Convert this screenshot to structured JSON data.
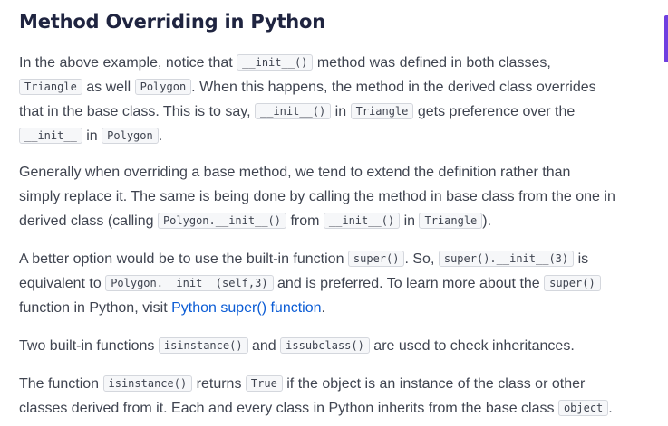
{
  "heading": "Method Overriding in Python",
  "p1": {
    "l1a": "In the above example, notice that ",
    "c1": "__init__()",
    "l1b": " method was defined in both classes,",
    "c2": "Triangle",
    "l2a": " as well ",
    "c3": "Polygon",
    "l2b": ". When this happens, the method in the derived class overrides",
    "l3a": "that in the base class. This is to say, ",
    "c4": "__init__()",
    "l3b": " in ",
    "c5": "Triangle",
    "l3c": " gets preference over the",
    "c6": "__init__",
    "l4a": " in ",
    "c7": "Polygon",
    "l4b": "."
  },
  "p2": {
    "l1": "Generally when overriding a base method, we tend to extend the definition rather than",
    "l2": "simply replace it. The same is being done by calling the method in base class from the one in",
    "l3a": "derived class (calling ",
    "c1": "Polygon.__init__()",
    "l3b": " from ",
    "c2": "__init__()",
    "l3c": " in ",
    "c3": "Triangle",
    "l3d": ")."
  },
  "p3": {
    "l1a": "A better option would be to use the built-in function ",
    "c1": "super()",
    "l1b": ". So, ",
    "c2": "super().__init__(3)",
    "l1c": " is",
    "l2a": "equivalent to ",
    "c3": "Polygon.__init__(self,3)",
    "l2b": " and is preferred. To learn more about the ",
    "c4": "super()",
    "l3a": "function in Python, visit ",
    "link": "Python super() function",
    "l3b": "."
  },
  "p4": {
    "l1a": "Two built-in functions ",
    "c1": "isinstance()",
    "l1b": " and ",
    "c2": "issubclass()",
    "l1c": " are used to check inheritances."
  },
  "p5": {
    "l1a": "The function ",
    "c1": "isinstance()",
    "l1b": " returns ",
    "c2": "True",
    "l1c": " if the object is an instance of the class or other",
    "l2a": "classes derived from it. Each and every class in Python inherits from the base class ",
    "c3": "object",
    "l2b": "."
  },
  "colors": {
    "heading": "#1f2440",
    "body_text": "#3f4450",
    "link": "#0b5cd5",
    "accent": "#6f3fe0",
    "code_bg": "#f6f7f9",
    "code_border": "#d4d7dd"
  }
}
